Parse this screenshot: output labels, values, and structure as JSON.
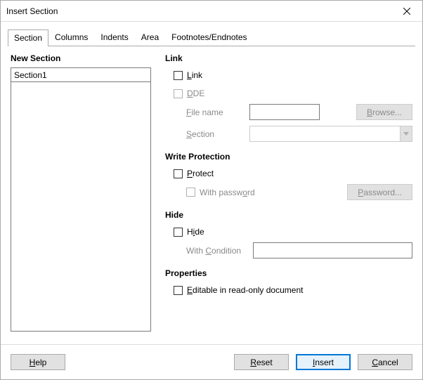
{
  "window": {
    "title": "Insert Section"
  },
  "tabs": [
    "Section",
    "Columns",
    "Indents",
    "Area",
    "Footnotes/Endnotes"
  ],
  "newSection": {
    "heading": "New Section",
    "name_value": "Section1"
  },
  "link": {
    "heading": "Link",
    "link_label": "Link",
    "dde_label": "DDE",
    "file_label": "File name",
    "section_label": "Section",
    "browse_label": "Browse..."
  },
  "writeProtection": {
    "heading": "Write Protection",
    "protect_label": "Protect",
    "withpw_label": "With password",
    "password_btn": "Password..."
  },
  "hide": {
    "heading": "Hide",
    "hide_label": "Hide",
    "condition_label": "With Condition"
  },
  "properties": {
    "heading": "Properties",
    "editable_label": "Editable in read-only document"
  },
  "buttons": {
    "help": "Help",
    "reset": "Reset",
    "insert": "Insert",
    "cancel": "Cancel"
  },
  "mnemonics": {
    "link_L": "L",
    "dde_D": "D",
    "file_F": "F",
    "section_S": "S",
    "browse_B": "B",
    "protect_P": "P",
    "withpw_o": "o",
    "passwordbtn_P": "P",
    "hide_i": "i",
    "condition_C": "C",
    "editable_E": "E",
    "help_H": "H",
    "reset_R": "R",
    "insert_I": "I",
    "cancel_C": "C"
  }
}
